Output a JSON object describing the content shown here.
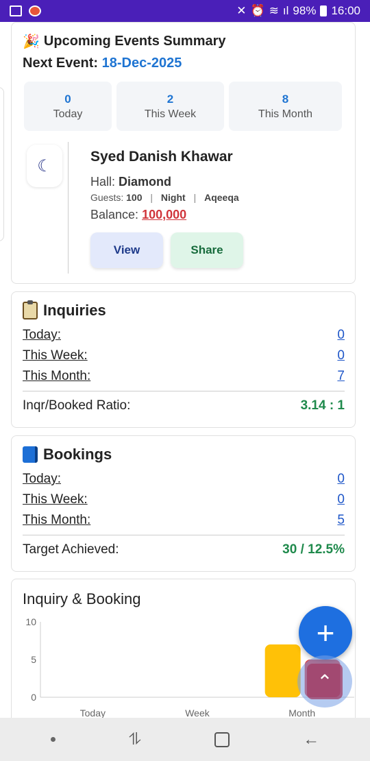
{
  "status": {
    "battery": "98%",
    "time": "16:00"
  },
  "events": {
    "title": "Upcoming Events Summary",
    "next_label": "Next Event:",
    "next_date": "18-Dec-2025",
    "stats": [
      {
        "num": "0",
        "label": "Today"
      },
      {
        "num": "2",
        "label": "This Week"
      },
      {
        "num": "8",
        "label": "This Month"
      }
    ],
    "event": {
      "name": "Syed Danish Khawar",
      "hall_label": "Hall:",
      "hall": "Diamond",
      "guests_label": "Guests:",
      "guests": "100",
      "time": "Night",
      "type": "Aqeeqa",
      "balance_label": "Balance:",
      "balance": "100,000",
      "icon": "moon-stars-icon"
    },
    "view_label": "View",
    "share_label": "Share"
  },
  "inquiries": {
    "title": "Inquiries",
    "rows": [
      {
        "k": "Today:",
        "v": "0"
      },
      {
        "k": "This Week:",
        "v": "0"
      },
      {
        "k": "This Month:",
        "v": "7"
      }
    ],
    "ratio_label": "Inqr/Booked Ratio:",
    "ratio_value": "3.14 : 1"
  },
  "bookings": {
    "title": "Bookings",
    "rows": [
      {
        "k": "Today:",
        "v": "0"
      },
      {
        "k": "This Week:",
        "v": "0"
      },
      {
        "k": "This Month:",
        "v": "5"
      }
    ],
    "target_label": "Target Achieved:",
    "target_value": "30 / 12.5%"
  },
  "chart_data": {
    "type": "bar",
    "title": "Inquiry & Booking",
    "categories": [
      "Today",
      "Week",
      "Month"
    ],
    "series": [
      {
        "values": [
          0,
          0,
          7
        ],
        "color": "#ffc107"
      },
      {
        "values": [
          0,
          0,
          5
        ],
        "color": "#e23b3b"
      }
    ],
    "yticks": [
      "0",
      "5",
      "10"
    ],
    "ylim": [
      0,
      10
    ]
  },
  "fab_label": "+"
}
